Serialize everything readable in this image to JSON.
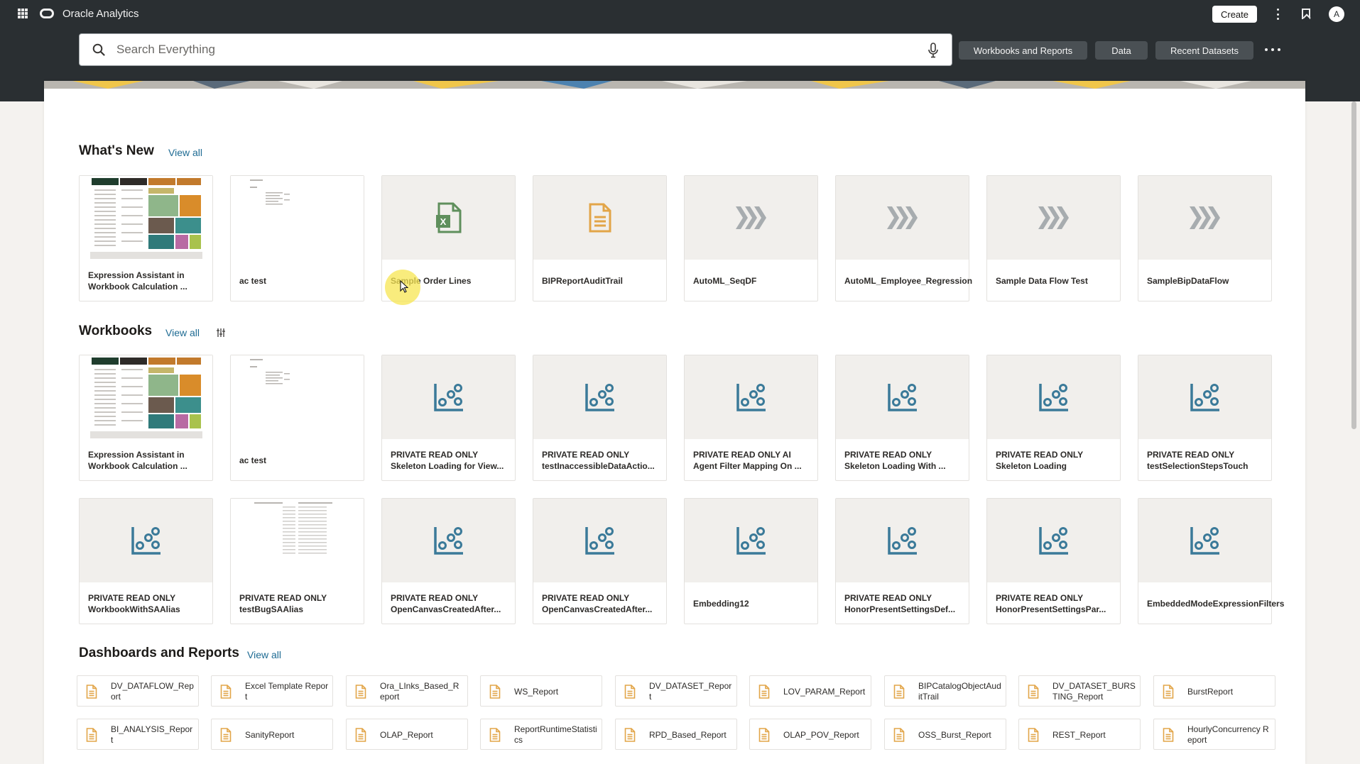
{
  "app": {
    "title": "Oracle Analytics",
    "create_label": "Create",
    "avatar_initial": "A"
  },
  "search": {
    "placeholder": "Search Everything"
  },
  "filters": [
    "Workbooks and Reports",
    "Data",
    "Recent Datasets"
  ],
  "whats_new": {
    "title": "What's New",
    "view_all": "View all",
    "items": [
      {
        "label": "Expression Assistant in Workbook Calculation ...",
        "thumb": "workbook-preview"
      },
      {
        "label": "ac test",
        "thumb": "sketch-preview"
      },
      {
        "label": "Sample Order Lines",
        "thumb": "excel-icon"
      },
      {
        "label": "BIPReportAuditTrail",
        "thumb": "report-doc-icon"
      },
      {
        "label": "AutoML_SeqDF",
        "thumb": "dataflow-icon"
      },
      {
        "label": "AutoML_Employee_Regression",
        "thumb": "dataflow-icon"
      },
      {
        "label": "Sample Data Flow Test",
        "thumb": "dataflow-icon"
      },
      {
        "label": "SampleBipDataFlow",
        "thumb": "dataflow-icon"
      }
    ]
  },
  "workbooks": {
    "title": "Workbooks",
    "view_all": "View all",
    "items": [
      {
        "label": "Expression Assistant in Workbook Calculation ...",
        "thumb": "workbook-preview"
      },
      {
        "label": "ac test",
        "thumb": "sketch-preview"
      },
      {
        "label": "PRIVATE READ ONLY Skeleton Loading for View...",
        "thumb": "scatter-icon"
      },
      {
        "label": "PRIVATE READ ONLY testInaccessibleDataActio...",
        "thumb": "scatter-icon"
      },
      {
        "label": "PRIVATE READ ONLY AI Agent Filter Mapping On ...",
        "thumb": "scatter-icon"
      },
      {
        "label": "PRIVATE READ ONLY Skeleton Loading With ...",
        "thumb": "scatter-icon"
      },
      {
        "label": "PRIVATE READ ONLY Skeleton Loading",
        "thumb": "scatter-icon"
      },
      {
        "label": "PRIVATE READ ONLY testSelectionStepsTouch",
        "thumb": "scatter-icon"
      },
      {
        "label": "PRIVATE READ ONLY WorkbookWithSAAlias",
        "thumb": "scatter-icon"
      },
      {
        "label": "PRIVATE READ ONLY testBugSAAlias",
        "thumb": "table-preview"
      },
      {
        "label": "PRIVATE READ ONLY OpenCanvasCreatedAfter...",
        "thumb": "scatter-icon"
      },
      {
        "label": "PRIVATE READ ONLY OpenCanvasCreatedAfter...",
        "thumb": "scatter-icon"
      },
      {
        "label": "Embedding12",
        "thumb": "scatter-icon"
      },
      {
        "label": "PRIVATE READ ONLY HonorPresentSettingsDef...",
        "thumb": "scatter-icon"
      },
      {
        "label": "PRIVATE READ ONLY HonorPresentSettingsPar...",
        "thumb": "scatter-icon"
      },
      {
        "label": "EmbeddedModeExpressionFilters",
        "thumb": "scatter-icon"
      }
    ]
  },
  "dashboards": {
    "title": "Dashboards and Reports",
    "view_all": "View all",
    "items": [
      "DV_DATAFLOW_Report",
      "Excel Template Report",
      "Ora_LInks_Based_Report",
      "WS_Report",
      "DV_DATASET_Report",
      "LOV_PARAM_Report",
      "BIPCatalogObjectAuditTrail",
      "DV_DATASET_BURSTING_Report",
      "BurstReport",
      "BI_ANALYSIS_Report",
      "SanityReport",
      "OLAP_Report",
      "ReportRuntimeStatistics",
      "RPD_Based_Report",
      "OLAP_POV_Report",
      "OSS_Burst_Report",
      "REST_Report",
      "HourlyConcurrency Report"
    ]
  },
  "colors": {
    "topbar": "#2a2f32",
    "accent_icon": "#3b7a99",
    "excel_green": "#5f8f5c",
    "doc_orange": "#e2a548",
    "dataflow_gray": "#a7acaf",
    "link": "#1e6b93"
  }
}
